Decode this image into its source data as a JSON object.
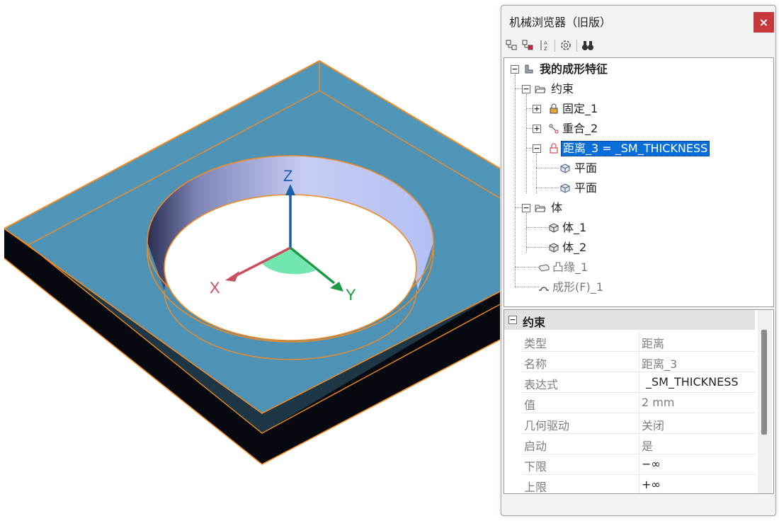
{
  "viewport": {
    "axes": {
      "x_label": "X",
      "y_label": "Y",
      "z_label": "Z"
    },
    "colors": {
      "plate_top": "#5096b8",
      "plate_side": "#0a0e18",
      "edge_highlight": "#f08a24",
      "axis_x": "#c8505c",
      "axis_y": "#1c9a48",
      "axis_z": "#1b5fa8"
    }
  },
  "panel": {
    "title": "机械浏览器（旧版）",
    "close_label": "×",
    "toolbar": [
      "tree-expand-icon",
      "tree-collapse-icon",
      "sort-az-icon",
      "settings-gear-icon",
      "binoculars-icon"
    ],
    "tree": {
      "root": "我的成形特征",
      "constraints_folder": "约束",
      "fixed": "固定_1",
      "coincident": "重合_2",
      "distance": "距离_3 =  _SM_THICKNESS",
      "plane1": "平面",
      "plane2": "平面",
      "bodies_folder": "体",
      "body1": "体_1",
      "body2": "体_2",
      "flange": "凸缘_1",
      "form": "成形(F)_1"
    },
    "properties": {
      "section": "约束",
      "rows": [
        {
          "key": "类型",
          "value": "距离"
        },
        {
          "key": "名称",
          "value": "距离_3"
        },
        {
          "key": "表达式",
          "value": "_SM_THICKNESS"
        },
        {
          "key": "值",
          "value": "2 mm"
        },
        {
          "key": "几何驱动",
          "value": "关闭"
        },
        {
          "key": "启动",
          "value": "是"
        },
        {
          "key": "下限",
          "value": "−∞"
        },
        {
          "key": "上限",
          "value": "+∞"
        }
      ]
    }
  }
}
